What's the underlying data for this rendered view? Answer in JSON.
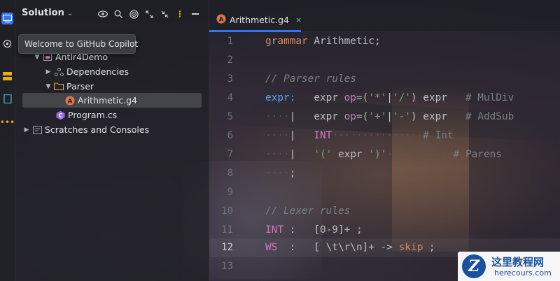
{
  "sidebar": {
    "title": "Solution",
    "tooltip": "Welcome to GitHub Copilot",
    "tools": [
      "eye-icon",
      "search-icon",
      "target-icon",
      "expand-icon",
      "collapse-icon",
      "more-icon",
      "minimize-icon"
    ],
    "tree": [
      {
        "label": "Antlr4Demo",
        "icon": "project-icon"
      },
      {
        "label": "Dependencies",
        "icon": "dependencies-icon"
      },
      {
        "label": "Parser",
        "icon": "folder-icon"
      },
      {
        "label": "Arithmetic.g4",
        "icon": "antlr-file-icon"
      },
      {
        "label": "Program.cs",
        "icon": "csharp-file-icon"
      },
      {
        "label": "Scratches and Consoles",
        "icon": "scratches-icon"
      }
    ]
  },
  "editor": {
    "tab": {
      "label": "Arithmetic.g4",
      "close": "×"
    },
    "line_numbers": [
      "1",
      "2",
      "3",
      "4",
      "5",
      "6",
      "7",
      "8",
      "9",
      "10",
      "11",
      "12",
      "13"
    ],
    "current_line": "12",
    "lines": {
      "l1": {
        "kw": "grammar",
        "rest": " Arithmetic;"
      },
      "l3": {
        "comment": "// Parser rules"
      },
      "l4": {
        "rule": "expr:",
        "a": "   expr ",
        "lbl": "op",
        "b": "=(",
        "s1": "'*'",
        "c": "|",
        "s2": "'/'",
        "d": ") expr   ",
        "tag": "# MulDiv"
      },
      "l5": {
        "dots": "····",
        "bar": "|",
        "a": "   expr ",
        "lbl": "op",
        "b": "=(",
        "s1": "'+'",
        "c": "|",
        "s2": "'-'",
        "d": ") expr   ",
        "tag": "# AddSub"
      },
      "l6": {
        "dots": "····",
        "bar": "|",
        "a": "   ",
        "tok": "INT",
        "fill": "···············",
        "tag": "# Int"
      },
      "l7": {
        "dots": "····",
        "bar": "|",
        "a": "   ",
        "s1": "'('",
        "b": " expr ",
        "s2": "')'",
        "fill": "···········",
        "tag": "# Parens"
      },
      "l8": {
        "dots": "····",
        "semi": ";"
      },
      "l10": {
        "comment": "// Lexer rules"
      },
      "l11": {
        "tok": "INT",
        "rest": " :   [0-9]+ ;"
      },
      "l12": {
        "tok": "WS",
        "rest": "  :   [ \\t\\r\\n]+ -> ",
        "kw": "skip",
        "end": " ;"
      }
    }
  },
  "watermark": {
    "line1": "这里教程网",
    "line2": "herecours.com",
    "logo": "Z"
  }
}
